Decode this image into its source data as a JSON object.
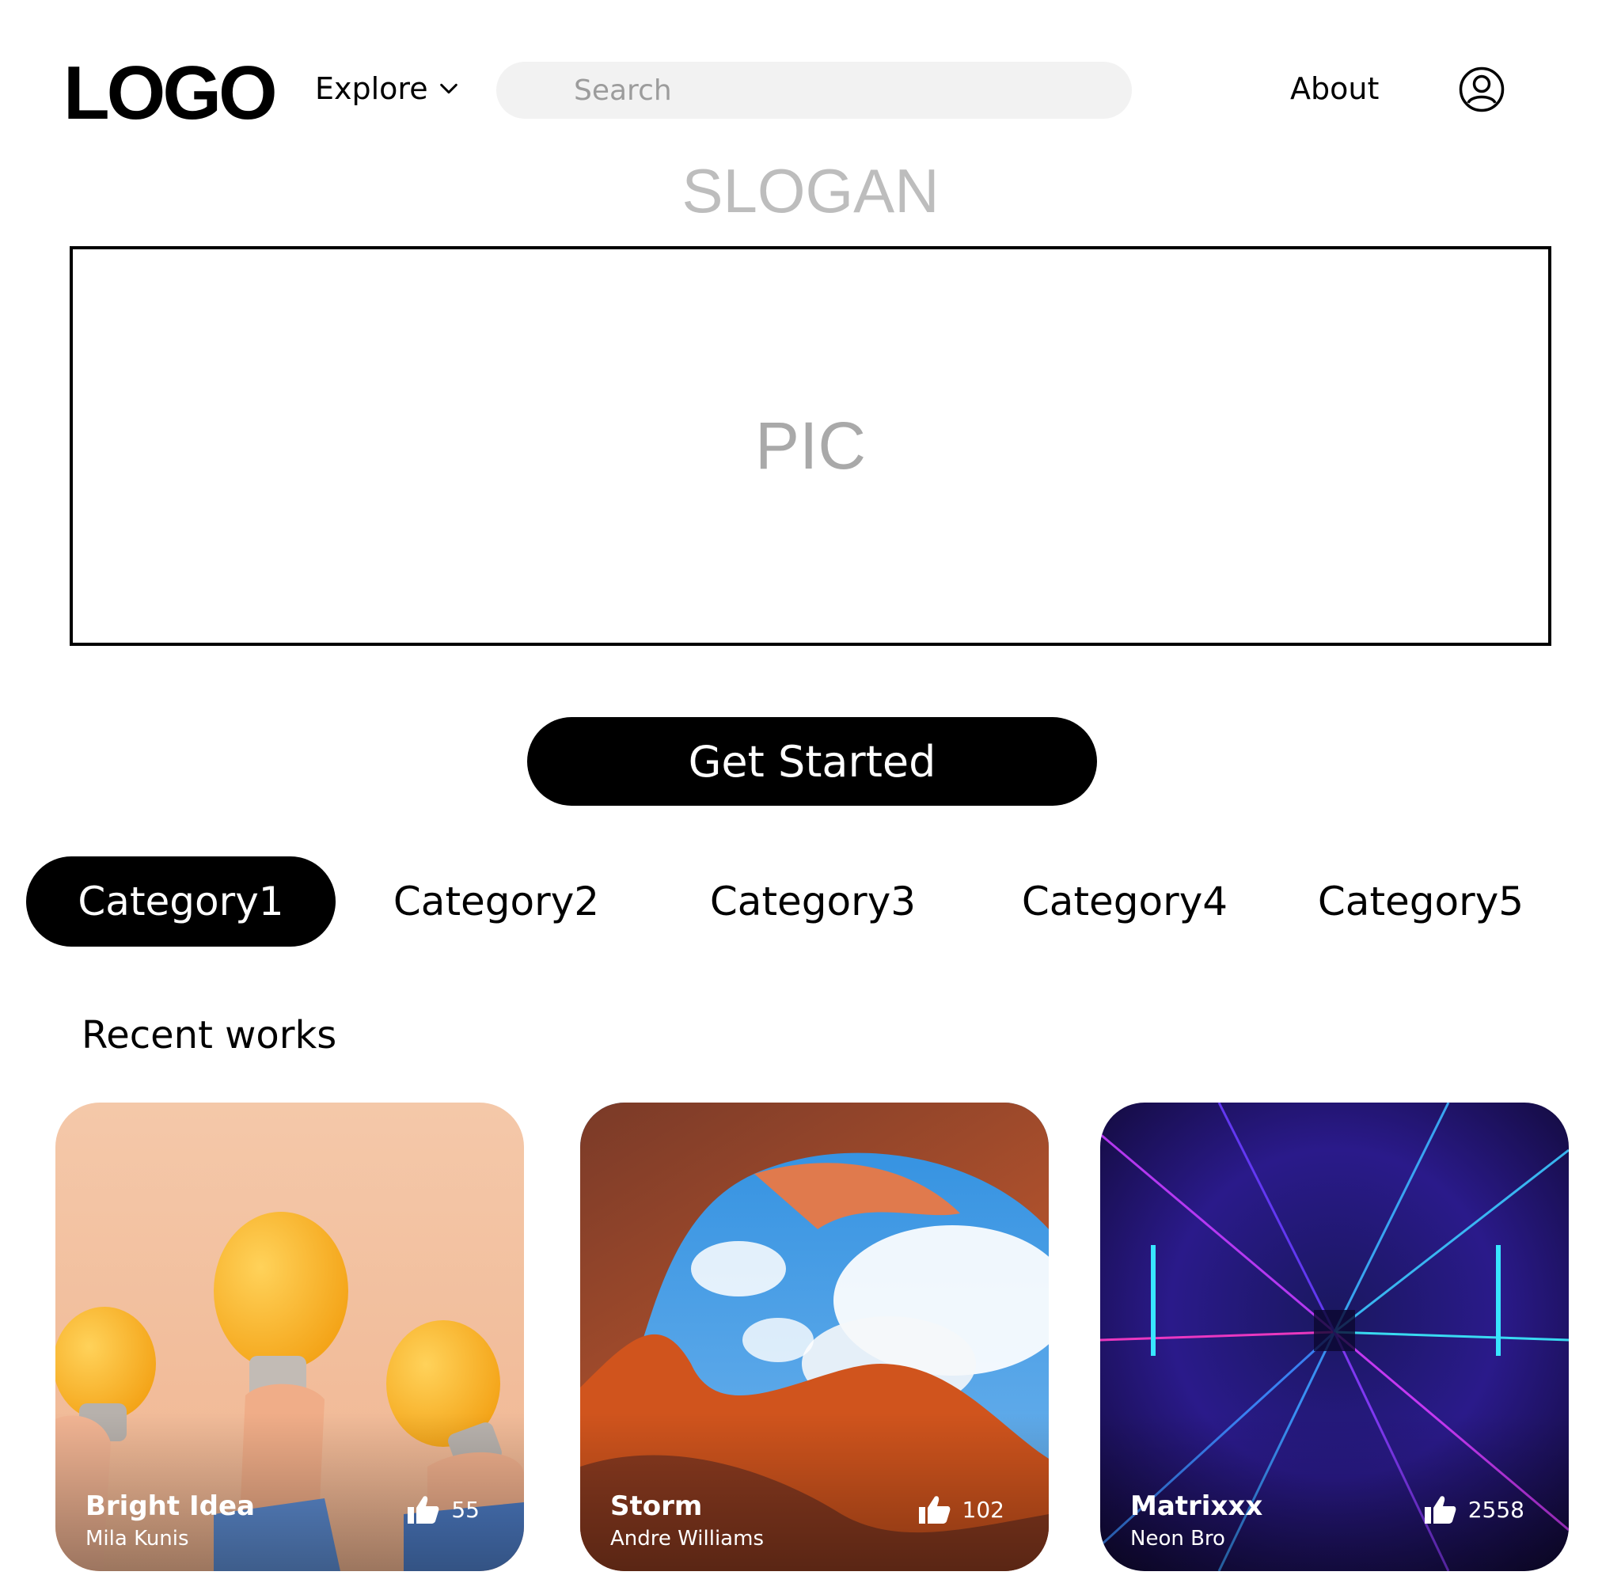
{
  "header": {
    "logo": "LOGO",
    "explore_label": "Explore",
    "search_placeholder": "Search",
    "about_label": "About"
  },
  "slogan": "SLOGAN",
  "hero": {
    "placeholder": "PIC"
  },
  "cta_label": "Get Started",
  "categories": [
    {
      "label": "Category1",
      "active": true
    },
    {
      "label": "Category2",
      "active": false
    },
    {
      "label": "Category3",
      "active": false
    },
    {
      "label": "Category4",
      "active": false
    },
    {
      "label": "Category5",
      "active": false
    }
  ],
  "recent": {
    "heading": "Recent works",
    "cards": [
      {
        "title": "Bright Idea",
        "author": "Mila Kunis",
        "likes": "55"
      },
      {
        "title": "Storm",
        "author": "Andre Williams",
        "likes": "102"
      },
      {
        "title": "Matrixxx",
        "author": "Neon Bro",
        "likes": "2558"
      }
    ]
  },
  "colors": {
    "accent": "#000000",
    "search_bg": "#f2f2f2",
    "muted_text": "#bdbdbd"
  }
}
